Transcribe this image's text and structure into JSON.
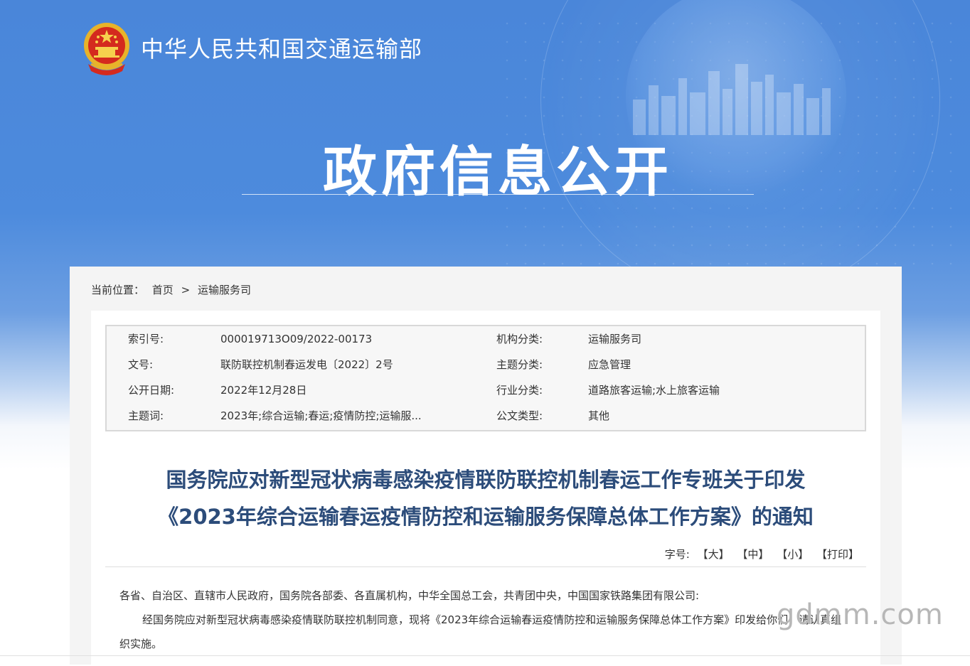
{
  "header": {
    "site_title": "中华人民共和国交通运输部",
    "page_title": "政府信息公开"
  },
  "breadcrumb": {
    "label": "当前位置：",
    "home": "首页",
    "separator": ">",
    "current": "运输服务司"
  },
  "meta": {
    "rows": [
      {
        "l1": "索引号:",
        "v1": "000019713O09/2022-00173",
        "l2": "机构分类:",
        "v2": "运输服务司"
      },
      {
        "l1": "文号:",
        "v1": "联防联控机制春运发电〔2022〕2号",
        "l2": "主题分类:",
        "v2": "应急管理"
      },
      {
        "l1": "公开日期:",
        "v1": "2022年12月28日",
        "l2": "行业分类:",
        "v2": "道路旅客运输;水上旅客运输"
      },
      {
        "l1": "主题词:",
        "v1": "2023年;综合运输;春运;疫情防控;运输服...",
        "l2": "公文类型:",
        "v2": "其他"
      }
    ]
  },
  "document": {
    "title_line1": "国务院应对新型冠状病毒感染疫情联防联控机制春运工作专班关于印发",
    "title_line2": "《2023年综合运输春运疫情防控和运输服务保障总体工作方案》的通知",
    "font_size_label": "字号:",
    "font_large": "【大】",
    "font_medium": "【中】",
    "font_small": "【小】",
    "print": "【打印】",
    "recipients": "各省、自治区、直辖市人民政府，国务院各部委、各直属机构，中华全国总工会，共青团中央，中国国家铁路集团有限公司:",
    "paragraph1": "经国务院应对新型冠状病毒感染疫情联防联控机制同意，现将《2023年综合运输春运疫情防控和运输服务保障总体工作方案》印发给你们，请认真组织实施。"
  },
  "watermark": "gdmm.com",
  "colors": {
    "banner_blue": "#4a86d9",
    "heading_blue": "#2c4c7a",
    "text": "#333333"
  }
}
